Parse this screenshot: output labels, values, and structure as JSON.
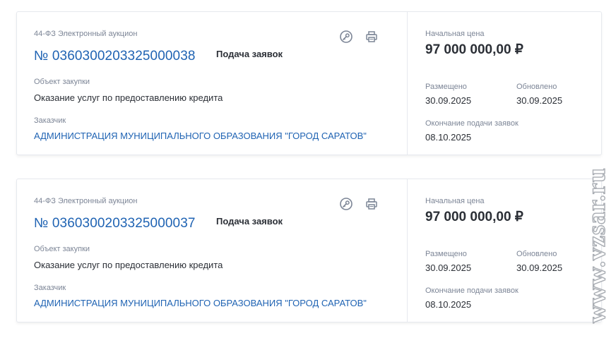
{
  "cards": [
    {
      "law_type": "44-ФЗ Электронный аукцион",
      "number": "№ 0360300203325000038",
      "status": "Подача заявок",
      "object_label": "Объект закупки",
      "object_value": "Оказание услуг по предоставлению кредита",
      "customer_label": "Заказчик",
      "customer_value": "АДМИНИСТРАЦИЯ МУНИЦИПАЛЬНОГО ОБРАЗОВАНИЯ \"ГОРОД САРАТОВ\"",
      "price_label": "Начальная цена",
      "price_value": "97 000 000,00 ₽",
      "posted_label": "Размещено",
      "posted_value": "30.09.2025",
      "updated_label": "Обновлено",
      "updated_value": "30.09.2025",
      "deadline_label": "Окончание подачи заявок",
      "deadline_value": "08.10.2025"
    },
    {
      "law_type": "44-ФЗ Электронный аукцион",
      "number": "№ 0360300203325000037",
      "status": "Подача заявок",
      "object_label": "Объект закупки",
      "object_value": "Оказание услуг по предоставлению кредита",
      "customer_label": "Заказчик",
      "customer_value": "АДМИНИСТРАЦИЯ МУНИЦИПАЛЬНОГО ОБРАЗОВАНИЯ \"ГОРОД САРАТОВ\"",
      "price_label": "Начальная цена",
      "price_value": "97 000 000,00 ₽",
      "posted_label": "Размещено",
      "posted_value": "30.09.2025",
      "updated_label": "Обновлено",
      "updated_value": "30.09.2025",
      "deadline_label": "Окончание подачи заявок",
      "deadline_value": "08.10.2025"
    }
  ],
  "icons": {
    "key": "key-icon",
    "print": "printer-icon"
  },
  "watermark": {
    "text": "www.vzsar.ru"
  },
  "colors": {
    "link": "#1f63b3",
    "muted": "#7c8596",
    "text": "#2b2f36",
    "border": "#e6e9ee"
  }
}
